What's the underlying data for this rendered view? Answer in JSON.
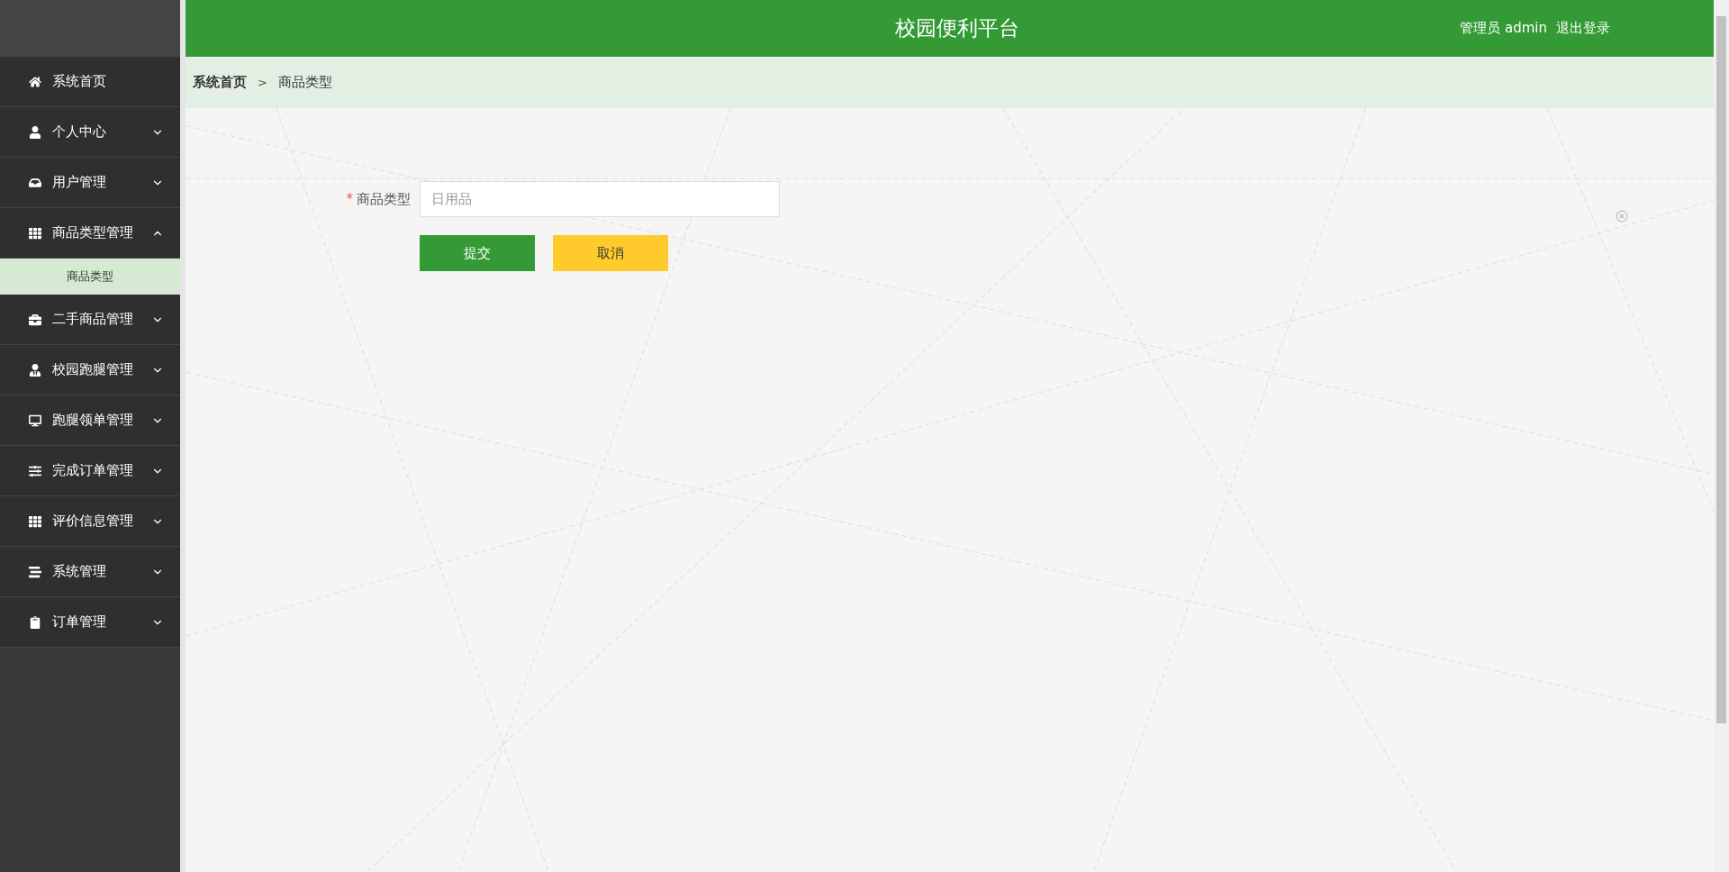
{
  "header": {
    "title": "校园便利平台",
    "user_role": "管理员",
    "user_name": "admin",
    "logout": "退出登录"
  },
  "sidebar": {
    "items": [
      {
        "kind": "link",
        "label": "系统首页"
      },
      {
        "kind": "group",
        "label": "个人中心",
        "expanded": false
      },
      {
        "kind": "group",
        "label": "用户管理",
        "expanded": false
      },
      {
        "kind": "group",
        "label": "商品类型管理",
        "expanded": true,
        "children": [
          {
            "label": "商品类型",
            "selected": true
          }
        ]
      },
      {
        "kind": "group",
        "label": "二手商品管理",
        "expanded": false
      },
      {
        "kind": "group",
        "label": "校园跑腿管理",
        "expanded": false
      },
      {
        "kind": "group",
        "label": "跑腿领单管理",
        "expanded": false
      },
      {
        "kind": "group",
        "label": "完成订单管理",
        "expanded": false
      },
      {
        "kind": "group",
        "label": "评价信息管理",
        "expanded": false
      },
      {
        "kind": "group",
        "label": "系统管理",
        "expanded": false
      },
      {
        "kind": "group",
        "label": "订单管理",
        "expanded": false
      }
    ]
  },
  "breadcrumb": {
    "items": [
      "系统首页",
      "商品类型"
    ],
    "separator": ">"
  },
  "form": {
    "fields": [
      {
        "label": "商品类型",
        "required": true,
        "required_mark": "*",
        "placeholder": "日用品"
      }
    ],
    "buttons": [
      {
        "kind": "primary",
        "label": "提交"
      },
      {
        "kind": "cancel",
        "label": "取消"
      }
    ]
  }
}
